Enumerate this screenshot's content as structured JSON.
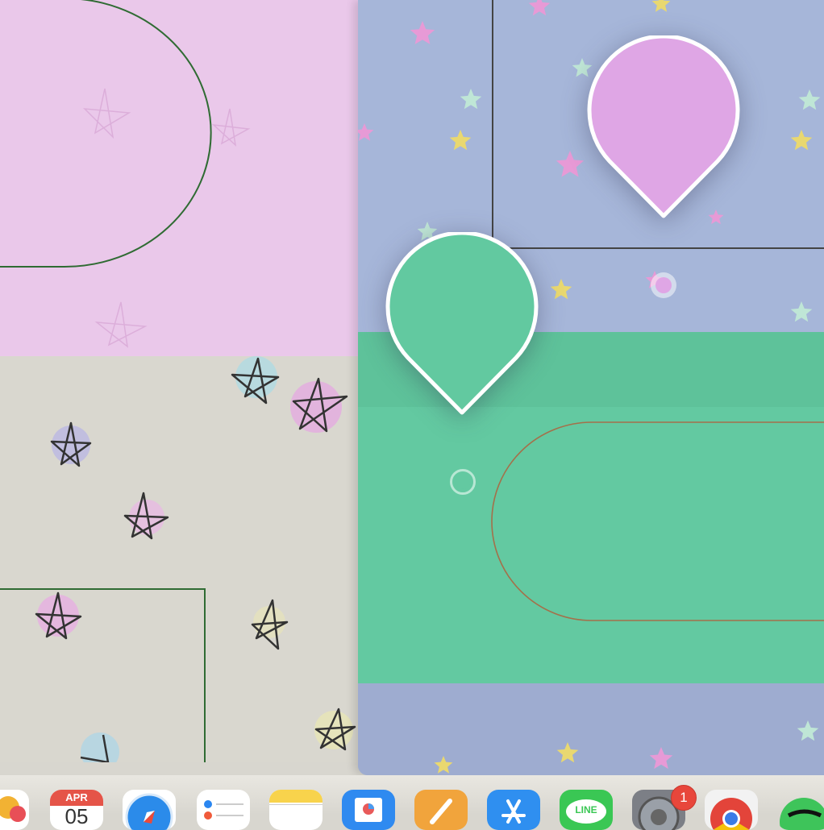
{
  "dock": {
    "calendar": {
      "month": "APR",
      "day": "05"
    },
    "line_label": "LINE",
    "settings_badge": "1",
    "apps": [
      "photos",
      "calendar",
      "safari",
      "reminders",
      "notes",
      "preview",
      "pages",
      "app-store",
      "line",
      "system-preferences",
      "chrome",
      "spotify"
    ]
  },
  "colors": {
    "pink_pin": "#dfa6e5",
    "green_pin": "#62c9a0",
    "left_pink_bg": "#eac8ea",
    "left_grey_bg": "#d9d7cf",
    "right_blue_bg": "#a6b6d9",
    "right_green_bg": "#63c9a1",
    "dock_bg": "#e9e7e1"
  },
  "icons": {
    "pin_pink": "location-pin-icon",
    "pin_green": "location-pin-icon",
    "anchor_dot": "target-dot-icon"
  }
}
